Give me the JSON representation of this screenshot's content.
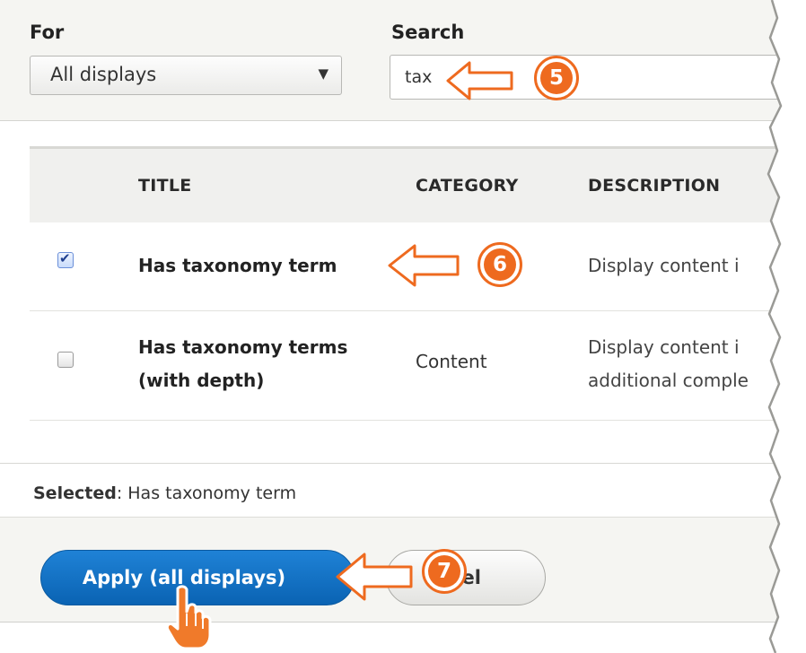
{
  "filters": {
    "for_label": "For",
    "for_value": "All displays",
    "search_label": "Search",
    "search_value": "tax"
  },
  "table": {
    "headers": {
      "title": "TITLE",
      "category": "CATEGORY",
      "description": "DESCRIPTION"
    },
    "rows": [
      {
        "checked": true,
        "title": "Has taxonomy term",
        "category": "",
        "description": "Display content i"
      },
      {
        "checked": false,
        "title": "Has taxonomy terms (with depth)",
        "category": "Content",
        "description_lines": [
          "Display content i",
          "additional comple"
        ]
      }
    ]
  },
  "selected": {
    "label": "Selected",
    "value": "Has taxonomy term"
  },
  "buttons": {
    "apply": "Apply (all displays)",
    "cancel": "cel"
  },
  "callouts": [
    {
      "number": "5"
    },
    {
      "number": "6"
    },
    {
      "number": "7"
    }
  ],
  "colors": {
    "accent": "#ee6a1f",
    "primary_button": "#0a63b3",
    "header_bg": "#f0f0ee"
  }
}
